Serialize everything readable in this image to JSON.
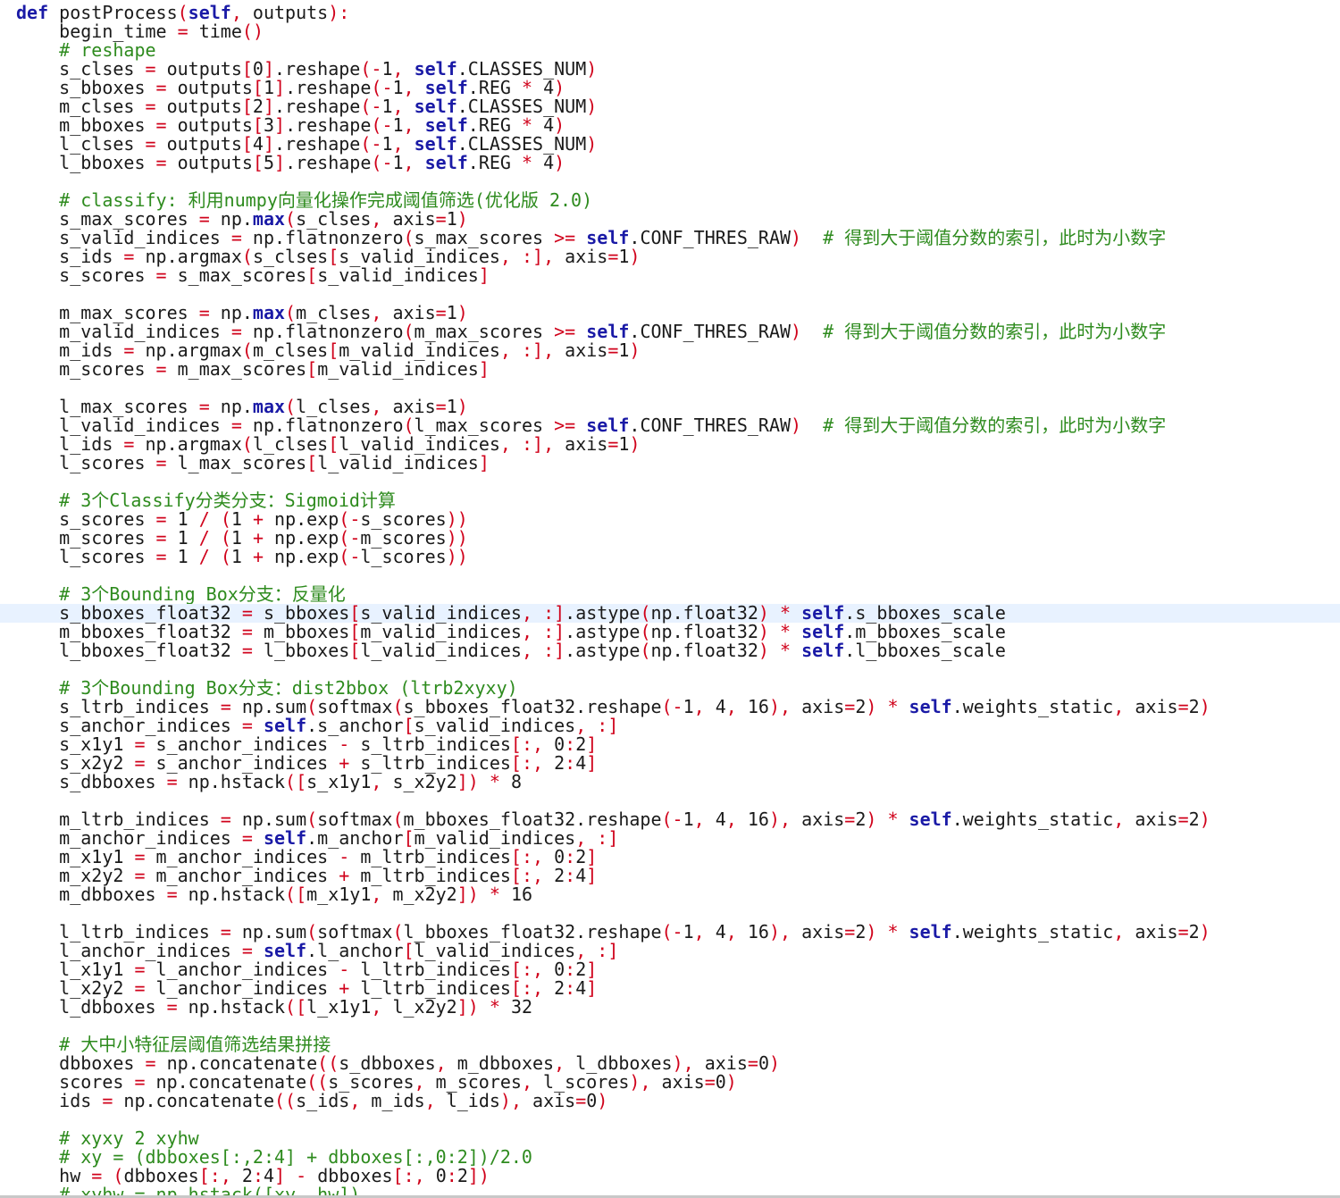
{
  "colors": {
    "background": "#ffffff",
    "text": "#1a1a1a",
    "keyword": "#1a1aa6",
    "comment": "#2e8b1e",
    "operator": "#d0021b",
    "highlight_line": "#e8f2ff"
  },
  "editor": {
    "highlighted_line_index": 32,
    "lines": [
      "def postProcess(self, outputs):",
      "    begin_time = time()",
      "    # reshape",
      "    s_clses = outputs[0].reshape(-1, self.CLASSES_NUM)",
      "    s_bboxes = outputs[1].reshape(-1, self.REG * 4)",
      "    m_clses = outputs[2].reshape(-1, self.CLASSES_NUM)",
      "    m_bboxes = outputs[3].reshape(-1, self.REG * 4)",
      "    l_clses = outputs[4].reshape(-1, self.CLASSES_NUM)",
      "    l_bboxes = outputs[5].reshape(-1, self.REG * 4)",
      "",
      "    # classify: 利用numpy向量化操作完成阈值筛选(优化版 2.0)",
      "    s_max_scores = np.max(s_clses, axis=1)",
      "    s_valid_indices = np.flatnonzero(s_max_scores >= self.CONF_THRES_RAW)  # 得到大于阈值分数的索引，此时为小数字",
      "    s_ids = np.argmax(s_clses[s_valid_indices, :], axis=1)",
      "    s_scores = s_max_scores[s_valid_indices]",
      "",
      "    m_max_scores = np.max(m_clses, axis=1)",
      "    m_valid_indices = np.flatnonzero(m_max_scores >= self.CONF_THRES_RAW)  # 得到大于阈值分数的索引，此时为小数字",
      "    m_ids = np.argmax(m_clses[m_valid_indices, :], axis=1)",
      "    m_scores = m_max_scores[m_valid_indices]",
      "",
      "    l_max_scores = np.max(l_clses, axis=1)",
      "    l_valid_indices = np.flatnonzero(l_max_scores >= self.CONF_THRES_RAW)  # 得到大于阈值分数的索引，此时为小数字",
      "    l_ids = np.argmax(l_clses[l_valid_indices, :], axis=1)",
      "    l_scores = l_max_scores[l_valid_indices]",
      "",
      "    # 3个Classify分类分支：Sigmoid计算",
      "    s_scores = 1 / (1 + np.exp(-s_scores))",
      "    m_scores = 1 / (1 + np.exp(-m_scores))",
      "    l_scores = 1 / (1 + np.exp(-l_scores))",
      "",
      "    # 3个Bounding Box分支：反量化",
      "    s_bboxes_float32 = s_bboxes[s_valid_indices, :].astype(np.float32) * self.s_bboxes_scale",
      "    m_bboxes_float32 = m_bboxes[m_valid_indices, :].astype(np.float32) * self.m_bboxes_scale",
      "    l_bboxes_float32 = l_bboxes[l_valid_indices, :].astype(np.float32) * self.l_bboxes_scale",
      "",
      "    # 3个Bounding Box分支：dist2bbox (ltrb2xyxy)",
      "    s_ltrb_indices = np.sum(softmax(s_bboxes_float32.reshape(-1, 4, 16), axis=2) * self.weights_static, axis=2)",
      "    s_anchor_indices = self.s_anchor[s_valid_indices, :]",
      "    s_x1y1 = s_anchor_indices - s_ltrb_indices[:, 0:2]",
      "    s_x2y2 = s_anchor_indices + s_ltrb_indices[:, 2:4]",
      "    s_dbboxes = np.hstack([s_x1y1, s_x2y2]) * 8",
      "",
      "    m_ltrb_indices = np.sum(softmax(m_bboxes_float32.reshape(-1, 4, 16), axis=2) * self.weights_static, axis=2)",
      "    m_anchor_indices = self.m_anchor[m_valid_indices, :]",
      "    m_x1y1 = m_anchor_indices - m_ltrb_indices[:, 0:2]",
      "    m_x2y2 = m_anchor_indices + m_ltrb_indices[:, 2:4]",
      "    m_dbboxes = np.hstack([m_x1y1, m_x2y2]) * 16",
      "",
      "    l_ltrb_indices = np.sum(softmax(l_bboxes_float32.reshape(-1, 4, 16), axis=2) * self.weights_static, axis=2)",
      "    l_anchor_indices = self.l_anchor[l_valid_indices, :]",
      "    l_x1y1 = l_anchor_indices - l_ltrb_indices[:, 0:2]",
      "    l_x2y2 = l_anchor_indices + l_ltrb_indices[:, 2:4]",
      "    l_dbboxes = np.hstack([l_x1y1, l_x2y2]) * 32",
      "",
      "    # 大中小特征层阈值筛选结果拼接",
      "    dbboxes = np.concatenate((s_dbboxes, m_dbboxes, l_dbboxes), axis=0)",
      "    scores = np.concatenate((s_scores, m_scores, l_scores), axis=0)",
      "    ids = np.concatenate((s_ids, m_ids, l_ids), axis=0)",
      "",
      "    # xyxy 2 xyhw",
      "    # xy = (dbboxes[:,2:4] + dbboxes[:,0:2])/2.0",
      "    hw = (dbboxes[:, 2:4] - dbboxes[:, 0:2])",
      "    # xyhw = np.hstack([xy, hw])"
    ]
  }
}
